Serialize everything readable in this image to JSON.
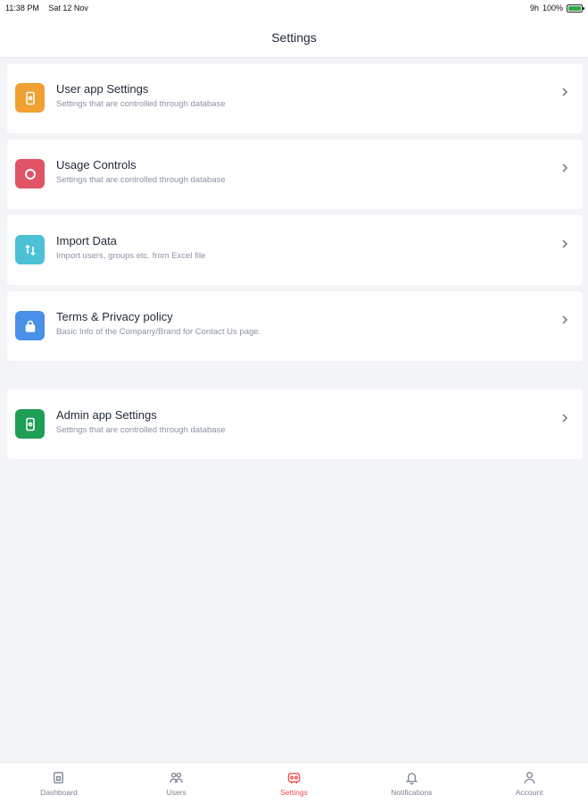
{
  "status_bar": {
    "time": "11:38 PM",
    "date": "Sat 12 Nov",
    "signal": "9h",
    "battery": "100%"
  },
  "header": {
    "title": "Settings"
  },
  "settings_items": [
    {
      "title": "User app Settings",
      "subtitle": "Settings that are controlled through database",
      "icon": "phone-settings-icon",
      "color": "#f0a132"
    },
    {
      "title": "Usage Controls",
      "subtitle": "Settings that are controlled through database",
      "icon": "donut-icon",
      "color": "#e05465"
    },
    {
      "title": "Import Data",
      "subtitle": "Import users, groups etc. from Excel file",
      "icon": "sort-arrows-icon",
      "color": "#4cc0d4"
    },
    {
      "title": "Terms & Privacy policy",
      "subtitle": "Basic Info of the Company/Brand for Contact Us page.",
      "icon": "lock-icon",
      "color": "#4a90e8"
    },
    {
      "title": "Admin app Settings",
      "subtitle": "Settings that are controlled through database",
      "icon": "phone-settings-icon",
      "color": "#1f9e55"
    }
  ],
  "tabs": [
    {
      "label": "Dashboard",
      "icon": "dashboard-icon",
      "active": false
    },
    {
      "label": "Users",
      "icon": "users-icon",
      "active": false
    },
    {
      "label": "Settings",
      "icon": "settings-icon",
      "active": true
    },
    {
      "label": "Notifications",
      "icon": "bell-icon",
      "active": false
    },
    {
      "label": "Account",
      "icon": "user-icon",
      "active": false
    }
  ],
  "colors": {
    "accent": "#ef4b4b",
    "background": "#f2f4f7",
    "card": "#ffffff",
    "muted_text": "#8a93a3"
  }
}
